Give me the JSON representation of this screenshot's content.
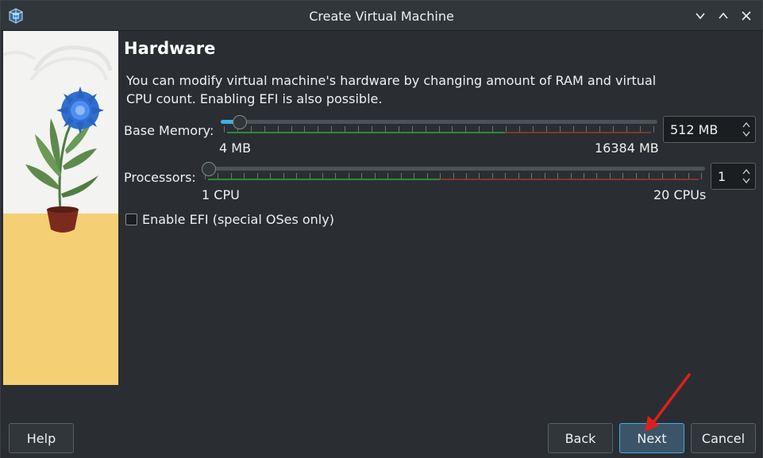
{
  "window": {
    "title": "Create Virtual Machine"
  },
  "page": {
    "heading": "Hardware",
    "description": "You can modify virtual machine's hardware by changing amount of RAM and virtual CPU count. Enabling EFI is also possible."
  },
  "memory": {
    "label": "Base Memory:",
    "min_label": "4 MB",
    "max_label": "16384 MB",
    "value_text": "512 MB",
    "value_mb": 512,
    "min_mb": 4,
    "max_mb": 16384
  },
  "processors": {
    "label": "Processors:",
    "min_label": "1 CPU",
    "max_label": "20 CPUs",
    "value_text": "1",
    "value": 1,
    "min": 1,
    "max": 20
  },
  "efi": {
    "label": "Enable EFI (special OSes only)",
    "checked": false
  },
  "buttons": {
    "help": "Help",
    "back": "Back",
    "next": "Next",
    "cancel": "Cancel"
  },
  "colors": {
    "accent": "#3daee9",
    "annotation_arrow": "#e0201b"
  }
}
